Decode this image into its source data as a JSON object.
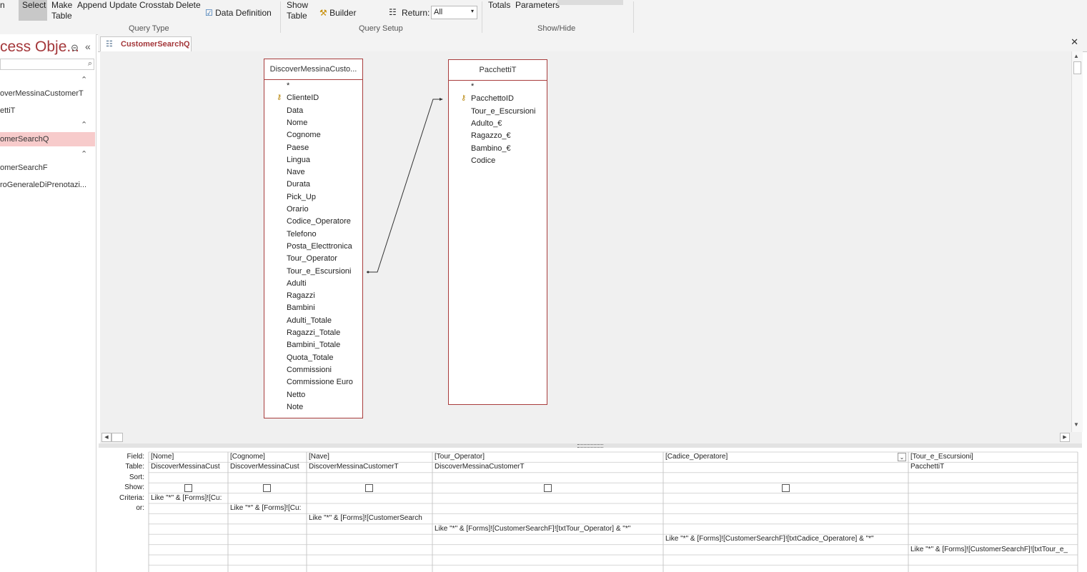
{
  "ribbon": {
    "select": "Select",
    "make_table_1": "Make",
    "make_table_2": "Table",
    "append": "Append",
    "update": "Update",
    "crosstab": "Crosstab",
    "delete": "Delete",
    "data_definition": "Data Definition",
    "show_table_1": "Show",
    "show_table_2": "Table",
    "builder": "Builder",
    "return_label": "Return:",
    "return_value": "All",
    "totals": "Totals",
    "parameters": "Parameters",
    "group_query_type": "Query Type",
    "group_query_setup": "Query Setup",
    "group_show_hide": "Show/Hide"
  },
  "nav": {
    "title": "cess Obje...",
    "items": [
      "overMessinaCustomerT",
      "ettiT",
      "omerSearchQ",
      "omerSearchF",
      "roGeneraleDiPrenotazi..."
    ]
  },
  "tab": {
    "label": "CustomerSearchQ"
  },
  "tables": [
    {
      "title": "DiscoverMessinaCusto...",
      "fields": [
        "*",
        "ClienteID",
        "Data",
        "Nome",
        "Cognome",
        "Paese",
        "Lingua",
        "Nave",
        "Durata",
        "Pick_Up",
        "Orario",
        "Codice_Operatore",
        "Telefono",
        "Posta_Electtronica",
        "Tour_Operator",
        "Tour_e_Escursioni",
        "Adulti",
        "Ragazzi",
        "Bambini",
        "Adulti_Totale",
        "Ragazzi_Totale",
        "Bambini_Totale",
        "Quota_Totale",
        "Commissioni",
        "Commissione Euro",
        "Netto",
        "Note"
      ]
    },
    {
      "title": "PacchettiT",
      "fields": [
        "*",
        "PacchettoID",
        "Tour_e_Escursioni",
        "Adulto_€",
        "Ragazzo_€",
        "Bambino_€",
        "Codice"
      ]
    }
  ],
  "grid": {
    "row_labels": [
      "Field:",
      "Table:",
      "Sort:",
      "Show:",
      "Criteria:",
      "or:"
    ],
    "columns": [
      {
        "field": "[Nome]",
        "table": "DiscoverMessinaCust",
        "show": true,
        "criteria": [
          "Like \"*\" & [Forms]![Cu:",
          "",
          "",
          "",
          "",
          ""
        ]
      },
      {
        "field": "[Cognome]",
        "table": "DiscoverMessinaCust",
        "show": true,
        "criteria": [
          "",
          "Like \"*\" & [Forms]![Cu:",
          "",
          "",
          "",
          ""
        ]
      },
      {
        "field": "[Nave]",
        "table": "DiscoverMessinaCustomerT",
        "show": true,
        "criteria": [
          "",
          "",
          "Like \"*\" & [Forms]![CustomerSearch",
          "",
          "",
          ""
        ]
      },
      {
        "field": "[Tour_Operator]",
        "table": "DiscoverMessinaCustomerT",
        "show": true,
        "criteria": [
          "",
          "",
          "",
          "Like \"*\" & [Forms]![CustomerSearchF]![txtTour_Operator] & \"*\"",
          "",
          ""
        ]
      },
      {
        "field": "[Cadice_Operatore]",
        "table": "",
        "show": true,
        "criteria": [
          "",
          "",
          "",
          "",
          "Like \"*\" & [Forms]![CustomerSearchF]![txtCadice_Operatore] & \"*\"",
          ""
        ]
      },
      {
        "field": "[Tour_e_Escursioni]",
        "table": "PacchettiT",
        "show": false,
        "criteria": [
          "",
          "",
          "",
          "",
          "",
          "Like \"*\" & [Forms]![CustomerSearchF]![txtTour_e_"
        ]
      }
    ]
  }
}
